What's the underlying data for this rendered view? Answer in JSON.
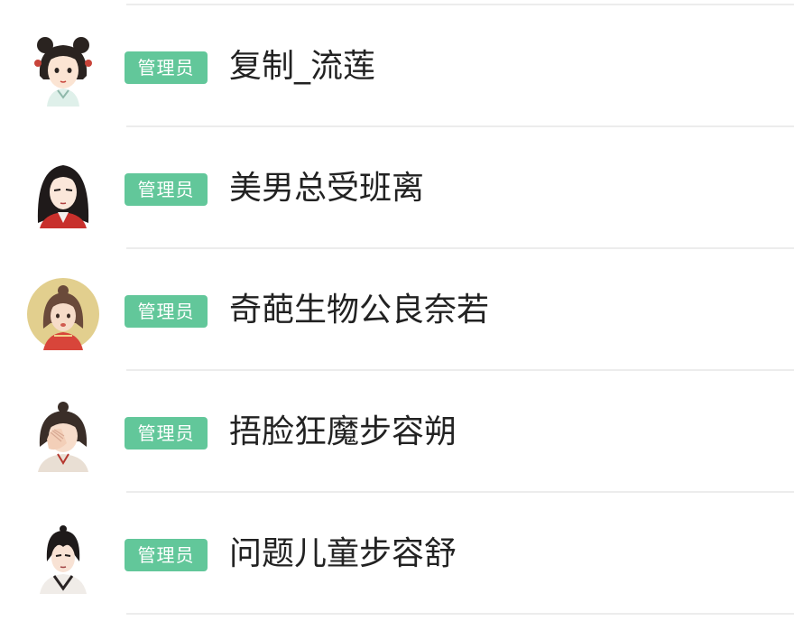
{
  "members": [
    {
      "role": "管理员",
      "name": "复制_流莲",
      "avatar_icon": "woman-hair-buns-avatar-icon"
    },
    {
      "role": "管理员",
      "name": "美男总受班离",
      "avatar_icon": "long-black-hair-avatar-icon"
    },
    {
      "role": "管理员",
      "name": "奇葩生物公良奈若",
      "avatar_icon": "gold-background-avatar-icon"
    },
    {
      "role": "管理员",
      "name": "捂脸狂魔步容朔",
      "avatar_icon": "face-covering-avatar-icon"
    },
    {
      "role": "管理员",
      "name": "问题儿童步容舒",
      "avatar_icon": "young-man-avatar-icon"
    }
  ],
  "colors": {
    "badge_background": "#62c79a",
    "badge_text": "#ffffff",
    "name_text": "#222222",
    "divider": "#ececec"
  }
}
